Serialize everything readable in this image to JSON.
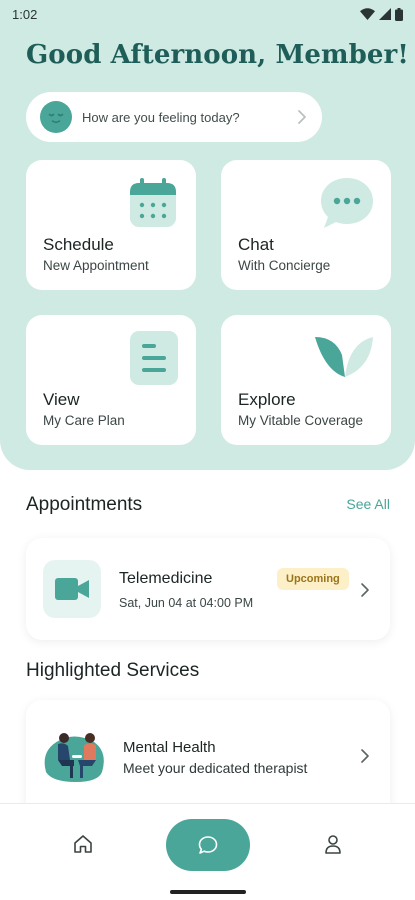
{
  "status_bar": {
    "time": "1:02"
  },
  "greeting": "Good Afternoon, Member!",
  "feeling_prompt": "How are you feeling today?",
  "tiles": [
    {
      "title": "Schedule",
      "subtitle": "New Appointment",
      "icon": "calendar-icon"
    },
    {
      "title": "Chat",
      "subtitle": "With Concierge",
      "icon": "chat-bubble-icon"
    },
    {
      "title": "View",
      "subtitle": "My Care Plan",
      "icon": "document-icon"
    },
    {
      "title": "Explore",
      "subtitle": "My Vitable Coverage",
      "icon": "vitable-logo-icon"
    }
  ],
  "appointments": {
    "section_title": "Appointments",
    "see_all": "See All",
    "items": [
      {
        "title": "Telemedicine",
        "datetime": "Sat, Jun 04 at 04:00 PM",
        "status": "Upcoming",
        "icon": "video-camera-icon"
      }
    ]
  },
  "services": {
    "section_title": "Highlighted Services",
    "items": [
      {
        "title": "Mental Health",
        "subtitle": "Meet your dedicated therapist",
        "icon": "therapy-illustration"
      }
    ]
  },
  "bottom_nav": [
    {
      "name": "home",
      "icon": "home-icon"
    },
    {
      "name": "chat",
      "icon": "chat-icon",
      "active": true
    },
    {
      "name": "profile",
      "icon": "profile-icon"
    }
  ],
  "colors": {
    "brand": "#4aa698",
    "hero_bg": "#cfeae2",
    "heading": "#1e5d58",
    "badge_bg": "#fdf0c8",
    "badge_text": "#9a7419"
  }
}
